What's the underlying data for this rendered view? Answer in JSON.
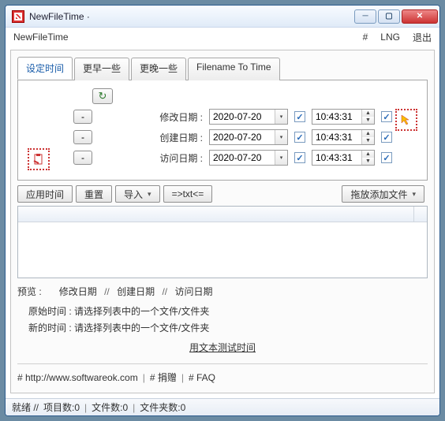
{
  "window": {
    "title": "NewFileTime ·"
  },
  "menubar": {
    "app_name": "NewFileTime",
    "hash": "#",
    "lng": "LNG",
    "exit": "退出"
  },
  "tabs": {
    "t0": "设定时间",
    "t1": "更早一些",
    "t2": "更晚一些",
    "t3": "Filename To Time"
  },
  "rows": {
    "r0": {
      "label": "修改日期 :",
      "date": "2020-07-20",
      "time": "10:43:31"
    },
    "r1": {
      "label": "创建日期 :",
      "date": "2020-07-20",
      "time": "10:43:31"
    },
    "r2": {
      "label": "访问日期 :",
      "date": "2020-07-20",
      "time": "10:43:31"
    }
  },
  "toolbar": {
    "apply": "应用时间",
    "reset": "重置",
    "import": "导入",
    "txt": "=>txt<=",
    "drag": "拖放添加文件"
  },
  "preview": {
    "label": "预览 :",
    "c0": "修改日期",
    "c1": "创建日期",
    "c2": "访问日期"
  },
  "info": {
    "orig_label": "原始时间 :",
    "orig_msg": "请选择列表中的一个文件/文件夹",
    "new_label": "新的时间 :",
    "new_msg": "请选择列表中的一个文件/文件夹",
    "test_link": "用文本测试时间"
  },
  "footer": {
    "url": "# http://www.softwareok.com",
    "donate": "# 捐赠",
    "faq": "# FAQ"
  },
  "status": {
    "ready": "就绪 //",
    "items": "项目数:0",
    "files": "文件数:0",
    "folders": "文件夹数:0"
  }
}
